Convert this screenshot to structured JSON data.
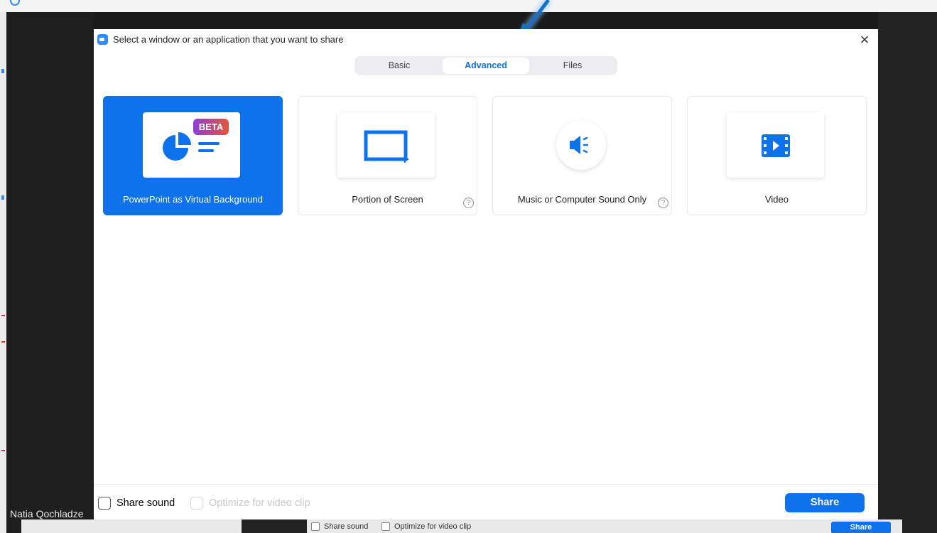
{
  "dialog": {
    "title": "Select a window or an application that you want to share",
    "close_label": "×"
  },
  "tabs": [
    {
      "label": "Basic",
      "active": false
    },
    {
      "label": "Advanced",
      "active": true
    },
    {
      "label": "Files",
      "active": false
    }
  ],
  "cards": [
    {
      "label": "PowerPoint as Virtual Background",
      "badge": "BETA",
      "icon": "pie-chart-icon",
      "selected": true,
      "help": false
    },
    {
      "label": "Portion of Screen",
      "icon": "screen-portion-icon",
      "selected": false,
      "help": true
    },
    {
      "label": "Music or Computer Sound Only",
      "icon": "speaker-icon",
      "selected": false,
      "help": true
    },
    {
      "label": "Video",
      "icon": "video-film-icon",
      "selected": false,
      "help": false
    }
  ],
  "help_glyph": "?",
  "footer": {
    "share_sound_label": "Share sound",
    "optimize_label": "Optimize for video clip",
    "share_button_label": "Share"
  },
  "background": {
    "participant_name": "Natia Qochladze",
    "share_sound_label": "Share sound",
    "optimize_label": "Optimize for video clip",
    "share_button_label": "Share"
  },
  "colors": {
    "accent": "#0e72ed",
    "beta_gradient_start": "#8b3fd9",
    "beta_gradient_end": "#e2563a"
  }
}
